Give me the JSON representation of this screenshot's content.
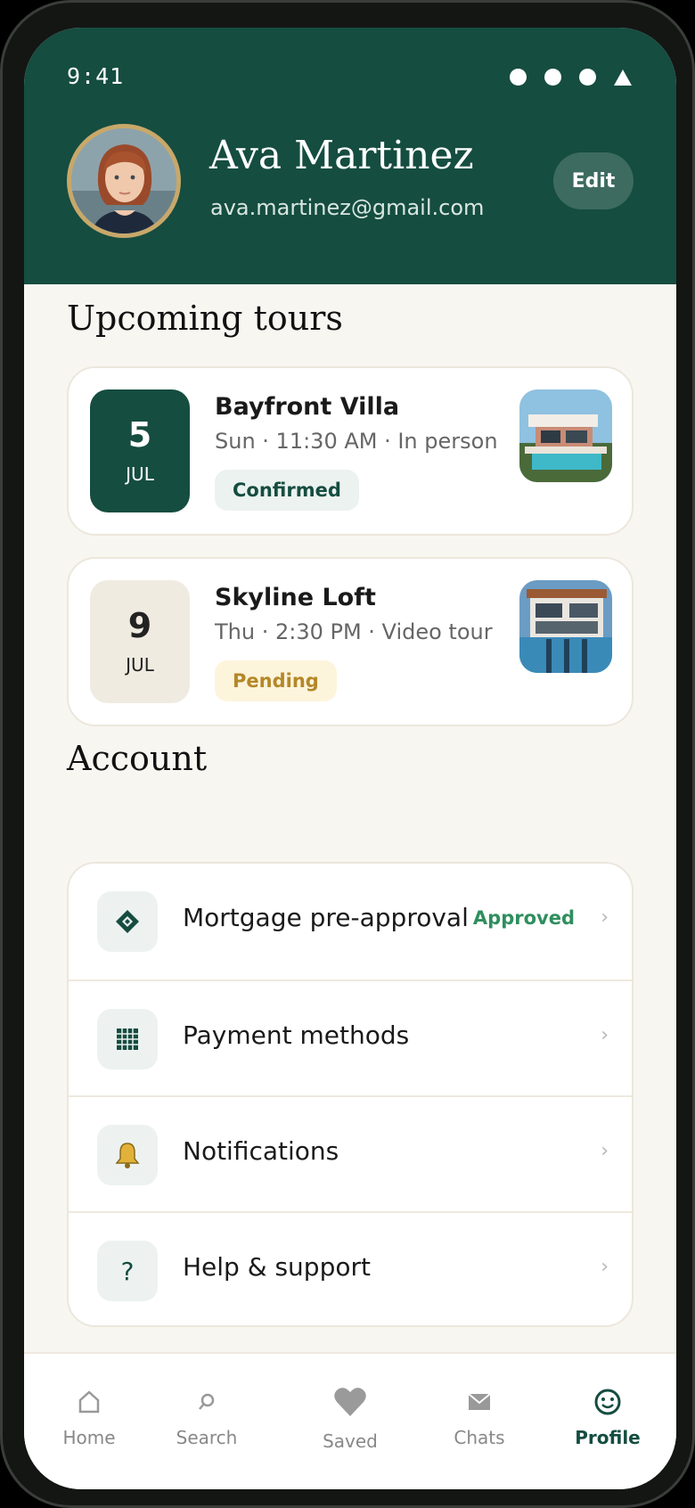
{
  "status_bar": {
    "time": "9:41"
  },
  "profile": {
    "name": "Ava Martinez",
    "email": "ava.martinez@gmail.com",
    "edit_label": "Edit"
  },
  "tours": {
    "title": "Upcoming tours",
    "items": [
      {
        "day": "5",
        "month": "JUL",
        "name": "Bayfront Villa",
        "meta": "Sun · 11:30 AM · In person",
        "status": "Confirmed"
      },
      {
        "day": "9",
        "month": "JUL",
        "name": "Skyline Loft",
        "meta": "Thu · 2:30 PM · Video tour",
        "status": "Pending"
      }
    ]
  },
  "account": {
    "title": "Account",
    "items": [
      {
        "label": "Mortgage pre-approval",
        "status": "Approved",
        "icon": "diamond-icon"
      },
      {
        "label": "Payment methods",
        "icon": "grid-card-icon"
      },
      {
        "label": "Notifications",
        "icon": "bell-icon"
      },
      {
        "label": "Help & support",
        "icon": "question-icon"
      }
    ]
  },
  "tabbar": {
    "items": [
      {
        "label": "Home",
        "icon": "home-icon"
      },
      {
        "label": "Search",
        "icon": "search-icon"
      },
      {
        "label": "Saved",
        "icon": "heart-icon"
      },
      {
        "label": "Chats",
        "icon": "mail-icon"
      },
      {
        "label": "Profile",
        "icon": "smiley-icon",
        "active": true
      }
    ]
  },
  "colors": {
    "brand": "#154d40",
    "approved": "#2f8e5e",
    "pending": "#b48828",
    "gold": "#c8a86a"
  }
}
